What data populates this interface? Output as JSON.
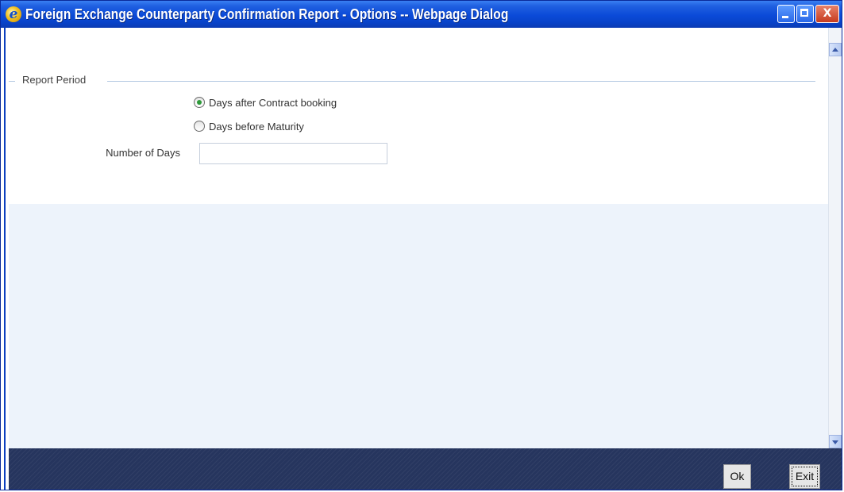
{
  "window": {
    "title": "Foreign Exchange Counterparty Confirmation Report - Options -- Webpage Dialog",
    "icon": "ie-icon"
  },
  "window_controls": {
    "minimize": "minimize",
    "maximize": "maximize",
    "close": "X"
  },
  "report_period": {
    "legend": "Report Period",
    "options": [
      {
        "label": "Days after Contract booking",
        "checked": true
      },
      {
        "label": "Days before Maturity",
        "checked": false
      }
    ],
    "number_of_days": {
      "label": "Number of Days",
      "value": ""
    }
  },
  "footer": {
    "ok_label": "Ok",
    "exit_label": "Exit"
  },
  "colors": {
    "titlebar": "#0b4ad8",
    "footer": "#26355e",
    "panel": "#edf3fb",
    "radio_checked": "#2e9a3a"
  }
}
